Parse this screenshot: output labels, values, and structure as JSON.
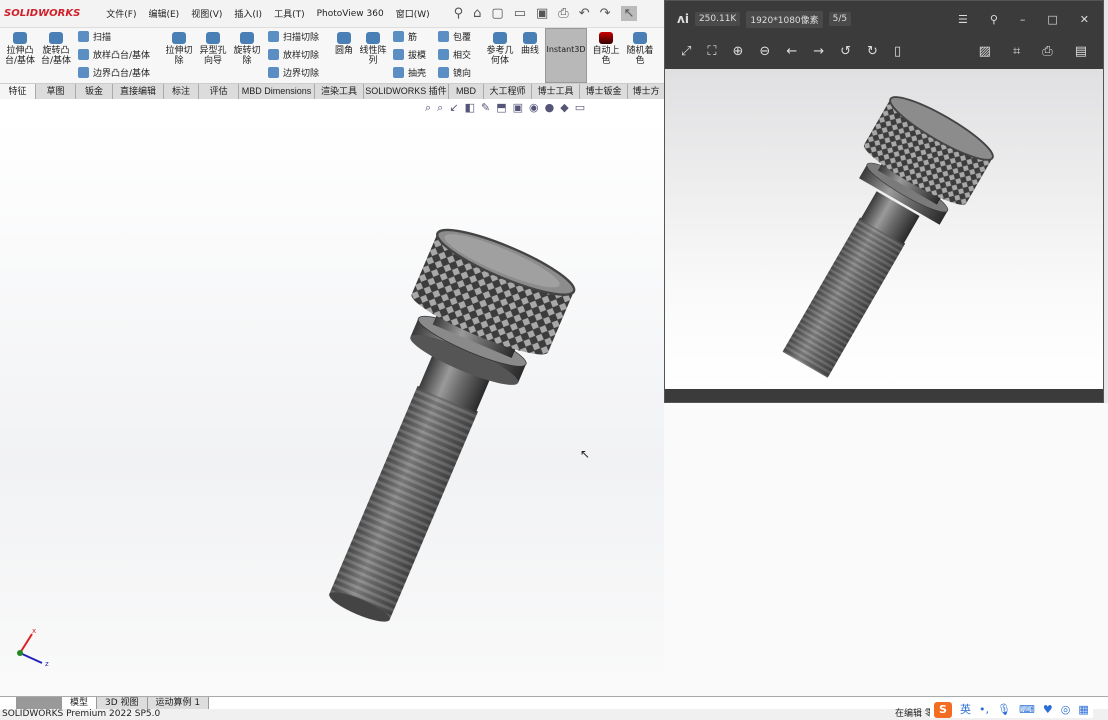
{
  "app": {
    "logo": "SOLIDWORKS",
    "menu": [
      "文件(F)",
      "编辑(E)",
      "视图(V)",
      "插入(I)",
      "工具(T)",
      "PhotoView 360",
      "窗口(W)"
    ]
  },
  "ribbon": {
    "big": [
      "拉伸凸台/基体",
      "旋转凸台/基体",
      "拉伸切除",
      "异型孔向导",
      "旋转切除",
      "圆角",
      "线性阵列",
      "参考几何体",
      "曲线",
      "Instant3D",
      "自动上色",
      "随机着色"
    ],
    "small": [
      "扫描",
      "放样凸台/基体",
      "边界凸台/基体",
      "扫描切除",
      "放样切除",
      "边界切除",
      "筋",
      "拔模",
      "抽壳",
      "包覆",
      "相交",
      "镜向"
    ]
  },
  "tabs": [
    "特征",
    "草图",
    "钣金",
    "直接编辑",
    "标注",
    "评估",
    "MBD Dimensions",
    "渲染工具",
    "SOLIDWORKS 插件",
    "MBD",
    "大工程师",
    "博士工具",
    "博士钣金",
    "博士方"
  ],
  "bottom_tabs": [
    "模型",
    "3D 视图",
    "运动算例 1"
  ],
  "status": {
    "version": "SOLIDWORKS Premium 2022 SP5.0",
    "editing": "在编辑 零"
  },
  "ime": {
    "logo": "S",
    "lang": "英"
  },
  "viewer": {
    "size": "250.11K",
    "resolution": "1920*1080像素",
    "page": "5/5"
  },
  "axes": {
    "x": "x",
    "z": "z"
  }
}
